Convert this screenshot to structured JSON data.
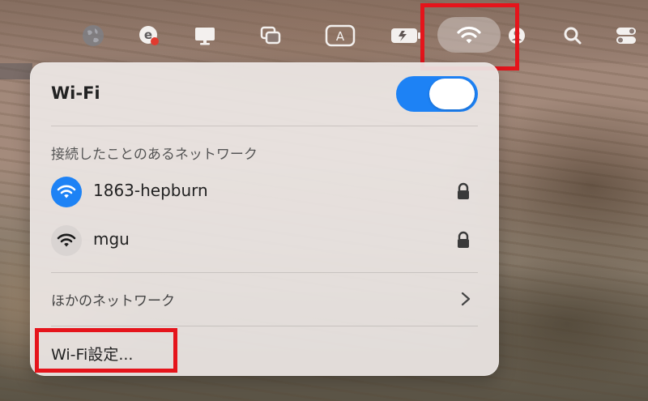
{
  "wifi_panel": {
    "title": "Wi-Fi",
    "toggle_on": true,
    "known_networks_label": "接続したことのあるネットワーク",
    "networks": [
      {
        "name": "1863-hepburn",
        "connected": true,
        "secured": true
      },
      {
        "name": "mgu",
        "connected": false,
        "secured": true
      }
    ],
    "other_networks_label": "ほかのネットワーク",
    "settings_label": "Wi-Fi設定..."
  },
  "menubar": {
    "icons": [
      "globe-icon",
      "extension-icon",
      "display-icon",
      "stage-manager-icon",
      "input-source-icon",
      "battery-charging-icon",
      "wifi-icon",
      "user-icon",
      "search-icon",
      "control-center-icon"
    ],
    "input_source_letter": "A",
    "highlighted": "wifi-icon"
  },
  "colors": {
    "accent": "#1d82f5",
    "highlight_box": "#e5141b",
    "panel_bg": "#ece6e4"
  }
}
